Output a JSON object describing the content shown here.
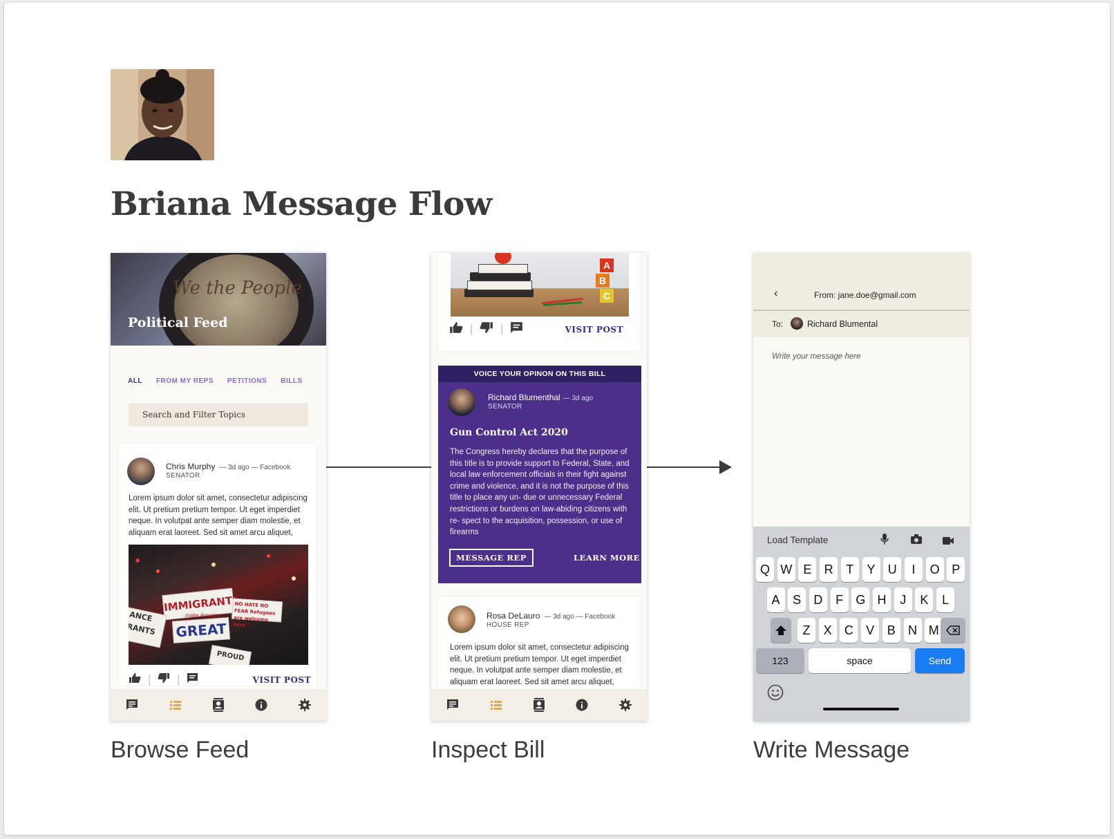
{
  "page": {
    "title": "Briana Message Flow",
    "captions": [
      "Browse Feed",
      "Inspect Bill",
      "Write Message"
    ]
  },
  "feed": {
    "hero_script": "We the People",
    "hero_title": "Political Feed",
    "tabs": [
      "ALL",
      "FROM MY REPS",
      "PETITIONS",
      "BILLS"
    ],
    "search_placeholder": "Search and Filter Topics",
    "post": {
      "name": "Chris Murphy",
      "meta": "— 3d ago — Facebook",
      "role": "SENATOR",
      "body": "Lorem ipsum dolor sit amet, consectetur adipiscing elit. Ut pretium pretium tempor. Ut eget imperdiet neque. In volutpat ante semper diam molestie, et aliquam erat laoreet. Sed sit amet arcu aliquet,",
      "sign_main": "IMMIGRANTS",
      "sign_sub": "make America",
      "sign_great": "GREAT",
      "sign_left": "ANCE RANTS",
      "sign_right": "NO HATE NO FEAR Refugees are welcome here",
      "sign_bottom": "PROUD",
      "visit": "VISIT POST"
    }
  },
  "bill": {
    "visit": "VISIT POST",
    "banner": "VOICE YOUR OPINON ON THIS BILL",
    "author": "Richard Blumenthal",
    "author_meta": "— 3d ago",
    "author_role": "SENATOR",
    "bill_title": "Gun Control Act 2020",
    "bill_body": "The Congress hereby declares that the purpose of this title is to provide support to Federal, State, and local law enforcement officials in their fight against crime and violence, and it is not the purpose of this title to place any un- due or unnecessary Federal restrictions or burdens on law-abiding citizens with re- spect to the acquisition, possession, or use of firearms",
    "message_rep": "MESSAGE REP",
    "learn_more": "LEARN MORE",
    "post2": {
      "name": "Rosa DeLauro",
      "meta": "— 3d ago — Facebook",
      "role": "HOUSE REP",
      "body": "Lorem ipsum dolor sit amet, consectetur adipiscing elit. Ut pretium pretium tempor. Ut eget imperdiet neque. In volutpat ante semper diam molestie, et aliquam erat laoreet. Sed sit amet arcu aliquet,"
    },
    "blocks": [
      "A",
      "B",
      "C"
    ]
  },
  "compose": {
    "from": "From: jane.doe@gmail.com",
    "to_label": "To:",
    "to_name": "Richard Blumental",
    "placeholder": "Write your message here",
    "load_template": "Load Template",
    "keys_row1": [
      "Q",
      "W",
      "E",
      "R",
      "T",
      "Y",
      "U",
      "I",
      "O",
      "P"
    ],
    "keys_row2": [
      "A",
      "S",
      "D",
      "F",
      "G",
      "H",
      "J",
      "K",
      "L"
    ],
    "keys_row3": [
      "Z",
      "X",
      "C",
      "V",
      "B",
      "N",
      "M"
    ],
    "key_123": "123",
    "key_space": "space",
    "key_send": "Send"
  },
  "colors": {
    "accent_purple": "#4b2f8a",
    "tab_purple": "#8a68c8",
    "send_blue": "#1a7cf2",
    "nav_active": "#d9a95a"
  },
  "icons": {
    "nav": [
      "chat-icon",
      "list-icon",
      "contacts-icon",
      "info-icon",
      "settings-icon"
    ],
    "actions": [
      "thumbs-up-icon",
      "thumbs-down-icon",
      "comment-icon"
    ]
  }
}
